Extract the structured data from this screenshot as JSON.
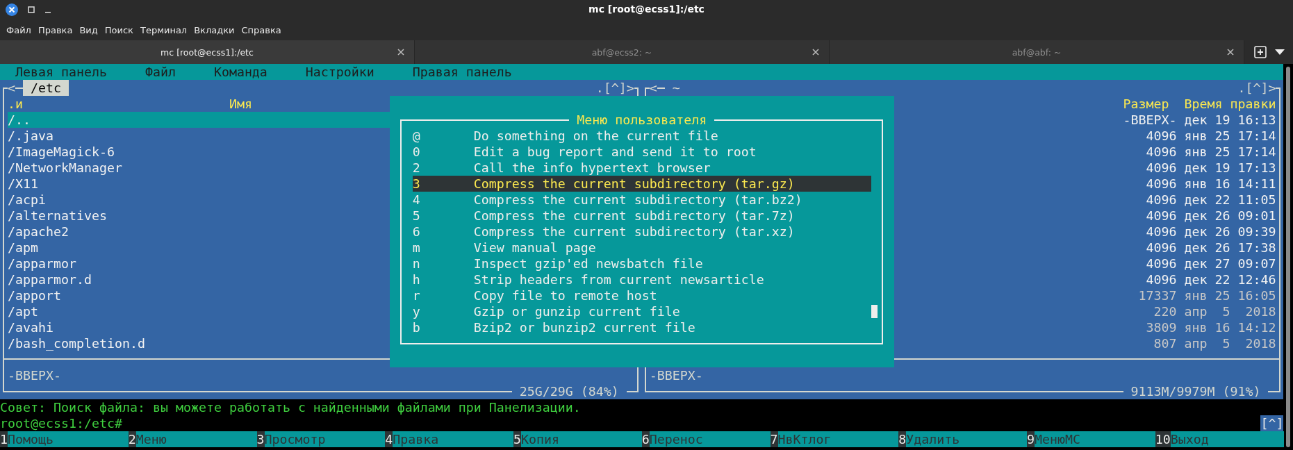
{
  "window": {
    "title": "mc [root@ecss1]:/etc"
  },
  "menu": [
    "Файл",
    "Правка",
    "Вид",
    "Поиск",
    "Терминал",
    "Вкладки",
    "Справка"
  ],
  "tabs": [
    {
      "label": "mc [root@ecss1]:/etc",
      "selected": true
    },
    {
      "label": "abf@ecss2: ~",
      "selected": false
    },
    {
      "label": "abf@abf: ~",
      "selected": false
    }
  ],
  "mc_menu": [
    "Левая панель",
    "Файл",
    "Команда",
    "Настройки",
    "Правая панель"
  ],
  "left_panel": {
    "active": true,
    "nav_left": "<",
    "path": "/etc",
    "nav_right": ".[^]>",
    "header": {
      "sort": ".и",
      "name": "Имя"
    },
    "rows": [
      {
        "name": "/..",
        "kind": "directory",
        "selected": true
      },
      {
        "name": "/.java",
        "kind": "directory",
        "selected": false
      },
      {
        "name": "/ImageMagick-6",
        "kind": "directory",
        "selected": false
      },
      {
        "name": "/NetworkManager",
        "kind": "directory",
        "selected": false
      },
      {
        "name": "/X11",
        "kind": "directory",
        "selected": false
      },
      {
        "name": "/acpi",
        "kind": "directory",
        "selected": false
      },
      {
        "name": "/alternatives",
        "kind": "directory",
        "selected": false
      },
      {
        "name": "/apache2",
        "kind": "directory",
        "selected": false
      },
      {
        "name": "/apm",
        "kind": "directory",
        "selected": false
      },
      {
        "name": "/apparmor",
        "kind": "directory",
        "selected": false
      },
      {
        "name": "/apparmor.d",
        "kind": "directory",
        "selected": false
      },
      {
        "name": "/apport",
        "kind": "directory",
        "selected": false
      },
      {
        "name": "/apt",
        "kind": "directory",
        "selected": false
      },
      {
        "name": "/avahi",
        "kind": "directory",
        "selected": false
      },
      {
        "name": "/bash_completion.d",
        "kind": "directory",
        "selected": false
      }
    ],
    "mini_status": "-ВВЕРХ-",
    "disk": "25G/29G (84%)"
  },
  "right_panel": {
    "active": false,
    "nav_left": "<",
    "path": "~",
    "nav_right": ".[^]>",
    "header": {
      "size": "Размер",
      "time": "Время правки"
    },
    "rows": [
      {
        "size": "-ВВЕРХ-",
        "time": "дек 19 16:13",
        "kind": "directory"
      },
      {
        "size": "4096",
        "time": "янв 25 17:14",
        "kind": "directory"
      },
      {
        "size": "4096",
        "time": "янв 25 17:14",
        "kind": "directory"
      },
      {
        "size": "4096",
        "time": "дек 19 17:13",
        "kind": "directory"
      },
      {
        "size": "4096",
        "time": "янв 16 14:11",
        "kind": "directory"
      },
      {
        "size": "4096",
        "time": "дек 22 11:05",
        "kind": "directory"
      },
      {
        "size": "4096",
        "time": "дек 26 09:01",
        "kind": "directory"
      },
      {
        "size": "4096",
        "time": "дек 26 09:39",
        "kind": "directory"
      },
      {
        "size": "4096",
        "time": "дек 26 17:38",
        "kind": "directory"
      },
      {
        "size": "4096",
        "time": "дек 27 09:07",
        "kind": "directory"
      },
      {
        "size": "4096",
        "time": "дек 22 12:46",
        "kind": "directory"
      },
      {
        "size": "17337",
        "time": "янв 25 16:05",
        "kind": "file"
      },
      {
        "size": "220",
        "time": "апр  5  2018",
        "kind": "file"
      },
      {
        "size": "3809",
        "time": "янв 16 14:12",
        "kind": "file"
      },
      {
        "size": "807",
        "time": "апр  5  2018",
        "kind": "file"
      }
    ],
    "mini_status": "-ВВЕРХ-",
    "disk": "9113M/9979M (91%)"
  },
  "user_menu": {
    "title": "Меню пользователя",
    "items": [
      {
        "key": "@",
        "label": "Do something on the current file",
        "selected": false
      },
      {
        "key": "0",
        "label": "Edit a bug report and send it to root",
        "selected": false
      },
      {
        "key": "2",
        "label": "Call the info hypertext browser",
        "selected": false
      },
      {
        "key": "3",
        "label": "Compress the current subdirectory (tar.gz)",
        "selected": true
      },
      {
        "key": "4",
        "label": "Compress the current subdirectory (tar.bz2)",
        "selected": false
      },
      {
        "key": "5",
        "label": "Compress the current subdirectory (tar.7z)",
        "selected": false
      },
      {
        "key": "6",
        "label": "Compress the current subdirectory (tar.xz)",
        "selected": false
      },
      {
        "key": "m",
        "label": "View manual page",
        "selected": false
      },
      {
        "key": "n",
        "label": "Inspect gzip'ed newsbatch file",
        "selected": false
      },
      {
        "key": "h",
        "label": "Strip headers from current newsarticle",
        "selected": false
      },
      {
        "key": "r",
        "label": "Copy file to remote host",
        "selected": false
      },
      {
        "key": "y",
        "label": "Gzip or gunzip current file",
        "selected": false
      },
      {
        "key": "b",
        "label": "Bzip2 or bunzip2 current file",
        "selected": false
      }
    ]
  },
  "hint": "Совет: Поиск файла: вы можете работать с найденными файлами при Панелизации.",
  "prompt": "root@ecss1:/etc#",
  "prompt_button": "[^]",
  "function_keys": [
    {
      "number": "1",
      "label": "Помощь"
    },
    {
      "number": "2",
      "label": "Меню"
    },
    {
      "number": "3",
      "label": "Просмотр"
    },
    {
      "number": "4",
      "label": "Правка"
    },
    {
      "number": "5",
      "label": "Копия"
    },
    {
      "number": "6",
      "label": "Перенос"
    },
    {
      "number": "7",
      "label": "НвКтлог"
    },
    {
      "number": "8",
      "label": "Удалить"
    },
    {
      "number": "9",
      "label": "МенюМС"
    },
    {
      "number": "10",
      "label": "Выход"
    }
  ]
}
